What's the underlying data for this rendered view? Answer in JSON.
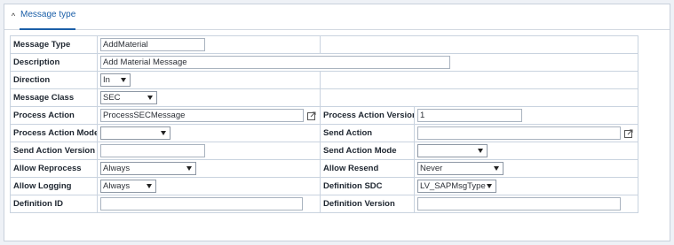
{
  "panel": {
    "tab_label": "Message type"
  },
  "form": {
    "message_type": {
      "label": "Message Type",
      "value": "AddMaterial"
    },
    "description": {
      "label": "Description",
      "value": "Add Material Message"
    },
    "direction": {
      "label": "Direction",
      "value": "In"
    },
    "message_class": {
      "label": "Message Class",
      "value": "SEC"
    },
    "process_action": {
      "label": "Process Action",
      "value": "ProcessSECMessage"
    },
    "process_action_version": {
      "label": "Process Action Version",
      "value": "1"
    },
    "process_action_mode": {
      "label": "Process Action Mode",
      "value": ""
    },
    "send_action": {
      "label": "Send Action",
      "value": ""
    },
    "send_action_version": {
      "label": "Send Action Version",
      "value": ""
    },
    "send_action_mode": {
      "label": "Send Action Mode",
      "value": ""
    },
    "allow_reprocess": {
      "label": "Allow Reprocess",
      "value": "Always"
    },
    "allow_resend": {
      "label": "Allow Resend",
      "value": "Never"
    },
    "allow_logging": {
      "label": "Allow Logging",
      "value": "Always"
    },
    "definition_sdc": {
      "label": "Definition SDC",
      "value": "LV_SAPMsgType"
    },
    "definition_id": {
      "label": "Definition ID",
      "value": ""
    },
    "definition_version": {
      "label": "Definition Version",
      "value": ""
    }
  },
  "icons": {
    "collapse": "chevron-up-icon",
    "external_link": "external-link-icon"
  },
  "colors": {
    "accent": "#1b5fa8",
    "border": "#c9d3df",
    "background": "#eef1f6"
  }
}
